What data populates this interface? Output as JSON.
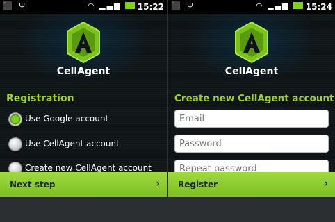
{
  "left_screen": {
    "status": {
      "time": "15:22"
    },
    "app_name": "CellAgent",
    "section_title": "Registration",
    "options": [
      {
        "label": "Use Google account",
        "checked": true
      },
      {
        "label": "Use CellAgent account",
        "checked": false
      },
      {
        "label": "Create new CellAgent account",
        "checked": false
      }
    ],
    "action_label": "Next step"
  },
  "right_screen": {
    "status": {
      "time": "15:24"
    },
    "app_name": "CellAgent",
    "section_title": "Create new CellAgent account",
    "fields": {
      "email_placeholder": "Email",
      "password_placeholder": "Password",
      "repeat_placeholder": "Repeat password"
    },
    "action_label": "Register"
  },
  "colors": {
    "accent": "#9ed02a",
    "bar": "#8ccc2e",
    "background": "#0f1416"
  },
  "icons": [
    "android-icon",
    "usb-icon",
    "wifi-icon",
    "signal-icon",
    "battery-icon",
    "chevron-right-icon"
  ]
}
